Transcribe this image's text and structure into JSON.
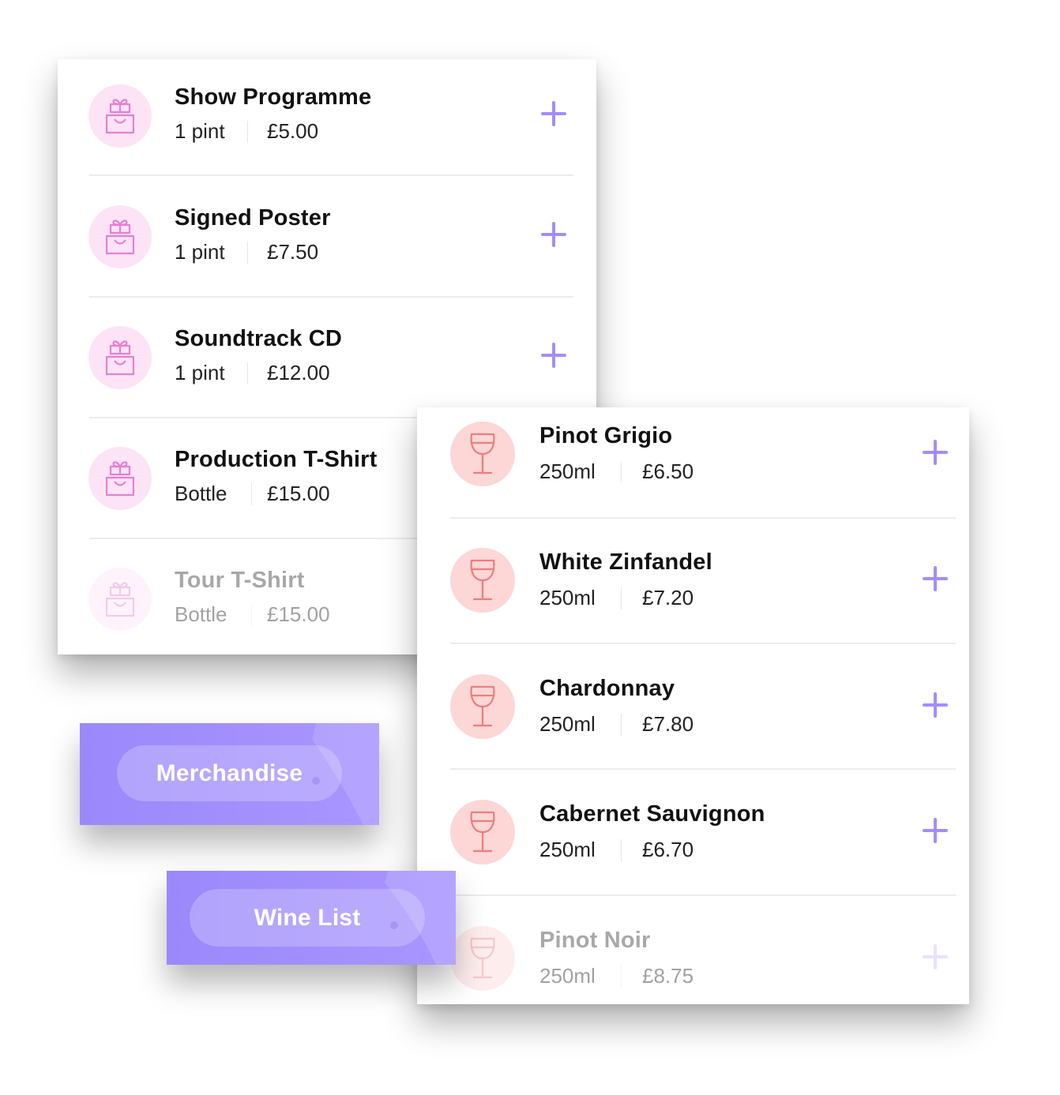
{
  "merchandise": {
    "icon": "gift-bag-icon",
    "items": [
      {
        "name": "Show Programme",
        "size": "1 pint",
        "price": "£5.00",
        "faded": false
      },
      {
        "name": "Signed Poster",
        "size": "1 pint",
        "price": "£7.50",
        "faded": false
      },
      {
        "name": "Soundtrack CD",
        "size": "1 pint",
        "price": "£12.00",
        "faded": false
      },
      {
        "name": "Production T-Shirt",
        "size": "Bottle",
        "price": "£15.00",
        "faded": false
      },
      {
        "name": "Tour T-Shirt",
        "size": "Bottle",
        "price": "£15.00",
        "faded": true
      }
    ]
  },
  "wine": {
    "icon": "wine-glass-icon",
    "items": [
      {
        "name": "Pinot Grigio",
        "size": "250ml",
        "price": "£6.50",
        "faded": false
      },
      {
        "name": "White Zinfandel",
        "size": "250ml",
        "price": "£7.20",
        "faded": false
      },
      {
        "name": "Chardonnay",
        "size": "250ml",
        "price": "£7.80",
        "faded": false
      },
      {
        "name": "Cabernet Sauvignon",
        "size": "250ml",
        "price": "£6.70",
        "faded": false
      },
      {
        "name": "Pinot Noir",
        "size": "250ml",
        "price": "£8.75",
        "faded": true
      }
    ]
  },
  "tabs": {
    "merchandise_label": "Merchandise",
    "wine_label": "Wine List"
  },
  "colors": {
    "accent": "#a48cff",
    "tab_bg": "#9b88fb",
    "merch_icon_bg": "#fde3f6",
    "merch_icon_stroke": "#e67fd3",
    "wine_icon_bg": "#fdd6d6",
    "wine_icon_stroke": "#ee7d7d"
  }
}
